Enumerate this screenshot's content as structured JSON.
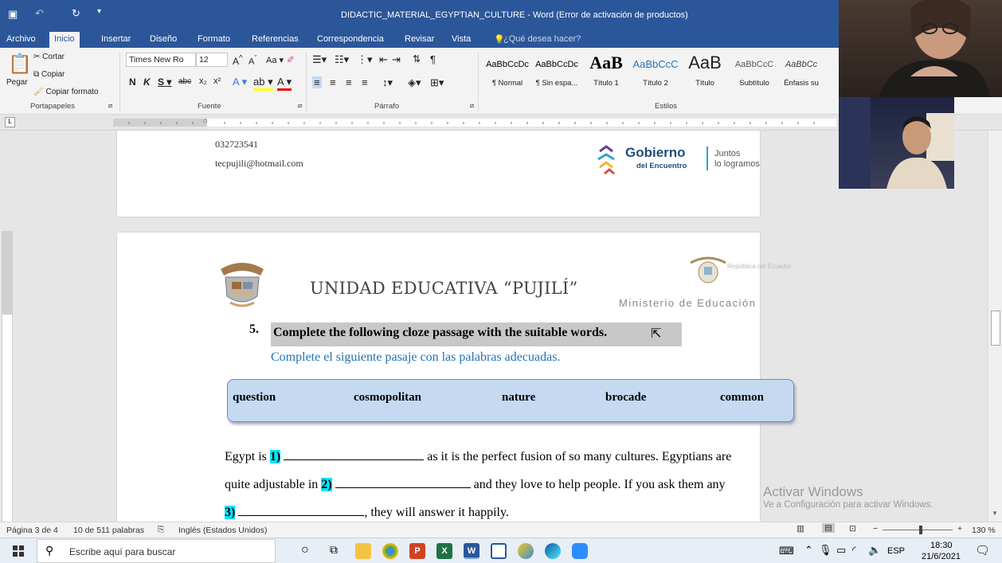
{
  "window": {
    "title": "DIDACTIC_MATERIAL_EGYPTIAN_CULTURE - Word (Error de activación de productos)"
  },
  "ribbon_tabs": [
    "Archivo",
    "Inicio",
    "Insertar",
    "Diseño",
    "Formato",
    "Referencias",
    "Correspondencia",
    "Revisar",
    "Vista"
  ],
  "tell_me": "¿Qué desea hacer?",
  "clipboard": {
    "cut": "Cortar",
    "copy": "Copiar",
    "paste": "Pegar",
    "format_painter": "Copiar formato",
    "label": "Portapapeles"
  },
  "font": {
    "name": "Times New Ro",
    "size": "12",
    "label": "Fuente"
  },
  "paragraph": {
    "label": "Párrafo"
  },
  "styles": {
    "label": "Estilos",
    "items": [
      {
        "preview": "AaBbCcDc",
        "name": "¶ Normal"
      },
      {
        "preview": "AaBbCcDc",
        "name": "¶ Sin espa..."
      },
      {
        "preview": "AaB",
        "name": "Título 1"
      },
      {
        "preview": "AaBbCcC",
        "name": "Título 2"
      },
      {
        "preview": "AaB",
        "name": "Título"
      },
      {
        "preview": "AaBbCcC",
        "name": "Subtítulo"
      },
      {
        "preview": "AaBbCc",
        "name": "Énfasis su"
      }
    ]
  },
  "page_top": {
    "phone": "032723541",
    "email": "tecpujili@hotmail.com",
    "logo_gobierno": "Gobierno",
    "logo_encuentro": "del Encuentro",
    "logo_juntos": "Juntos",
    "logo_lo": "lo logramos"
  },
  "page_main": {
    "school": "UNIDAD EDUCATIVA “PUJILÍ”",
    "republica": "República del Ecuador",
    "ministerio": "Ministerio de Educación",
    "q_number": "5.",
    "q_en": "Complete the following cloze passage with the suitable words.",
    "q_es": "Complete el siguiente pasaje con las palabras adecuadas.",
    "word_bank": [
      "question",
      "cosmopolitan",
      "nature",
      "brocade",
      "common"
    ],
    "line1_a": "Egypt is ",
    "line1_n": "1)",
    "line1_b": " as it is the perfect fusion of so many cultures. Egyptians are",
    "line2_a": "quite adjustable in ",
    "line2_n": "2)",
    "line2_b": " and they love to help people. If you ask them any",
    "line3_n": "3)",
    "line3_b": ", they will answer it happily."
  },
  "watermark": {
    "line1": "Activar Windows",
    "line2": "Ve a Configuración para activar Windows."
  },
  "status": {
    "page": "Página 3 de 4",
    "words": "10 de 511 palabras",
    "language": "Inglés (Estados Unidos)",
    "zoom": "130 %"
  },
  "taskbar": {
    "search_placeholder": "Escribe aquí para buscar",
    "lang": "ESP",
    "time": "18:30",
    "date": "21/6/2021"
  }
}
